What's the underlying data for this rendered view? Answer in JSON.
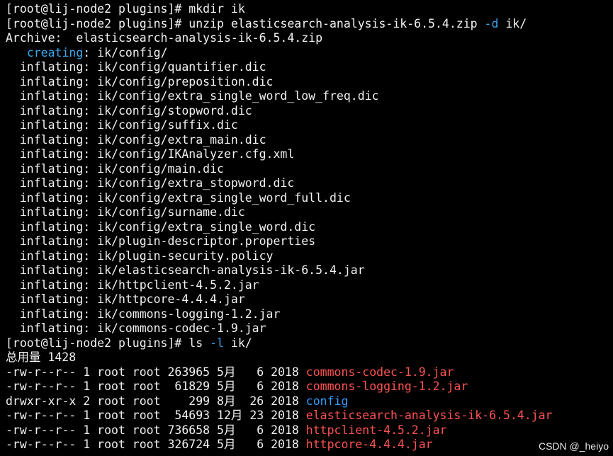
{
  "colors": {
    "text": "#f2f2f2",
    "background": "#000000",
    "cyan": "#38a8ee",
    "red": "#ff5252",
    "blue": "#2f9fff"
  },
  "lines": [
    {
      "segments": [
        {
          "text": "[root@lij-node2 plugins]# mkdir ik"
        }
      ]
    },
    {
      "segments": [
        {
          "text": "[root@lij-node2 plugins]# unzip elasticsearch-analysis-ik-6.5.4.zip "
        },
        {
          "text": "-d",
          "color": "cyan"
        },
        {
          "text": " ik/"
        }
      ]
    },
    {
      "segments": [
        {
          "text": "Archive:  elasticsearch-analysis-ik-6.5.4.zip"
        }
      ]
    },
    {
      "segments": [
        {
          "text": "   "
        },
        {
          "text": "creating",
          "color": "cyan"
        },
        {
          "text": ": ik/config/"
        }
      ]
    },
    {
      "segments": [
        {
          "text": "  inflating: ik/config/quantifier.dic"
        }
      ]
    },
    {
      "segments": [
        {
          "text": "  inflating: ik/config/preposition.dic"
        }
      ]
    },
    {
      "segments": [
        {
          "text": "  inflating: ik/config/extra_single_word_low_freq.dic"
        }
      ]
    },
    {
      "segments": [
        {
          "text": "  inflating: ik/config/stopword.dic"
        }
      ]
    },
    {
      "segments": [
        {
          "text": "  inflating: ik/config/suffix.dic"
        }
      ]
    },
    {
      "segments": [
        {
          "text": "  inflating: ik/config/extra_main.dic"
        }
      ]
    },
    {
      "segments": [
        {
          "text": "  inflating: ik/config/IKAnalyzer.cfg.xml"
        }
      ]
    },
    {
      "segments": [
        {
          "text": "  inflating: ik/config/main.dic"
        }
      ]
    },
    {
      "segments": [
        {
          "text": "  inflating: ik/config/extra_stopword.dic"
        }
      ]
    },
    {
      "segments": [
        {
          "text": "  inflating: ik/config/extra_single_word_full.dic"
        }
      ]
    },
    {
      "segments": [
        {
          "text": "  inflating: ik/config/surname.dic"
        }
      ]
    },
    {
      "segments": [
        {
          "text": "  inflating: ik/config/extra_single_word.dic"
        }
      ]
    },
    {
      "segments": [
        {
          "text": "  inflating: ik/plugin-descriptor.properties"
        }
      ]
    },
    {
      "segments": [
        {
          "text": "  inflating: ik/plugin-security.policy"
        }
      ]
    },
    {
      "segments": [
        {
          "text": "  inflating: ik/elasticsearch-analysis-ik-6.5.4.jar"
        }
      ]
    },
    {
      "segments": [
        {
          "text": "  inflating: ik/httpclient-4.5.2.jar"
        }
      ]
    },
    {
      "segments": [
        {
          "text": "  inflating: ik/httpcore-4.4.4.jar"
        }
      ]
    },
    {
      "segments": [
        {
          "text": "  inflating: ik/commons-logging-1.2.jar"
        }
      ]
    },
    {
      "segments": [
        {
          "text": "  inflating: ik/commons-codec-1.9.jar"
        }
      ]
    },
    {
      "segments": [
        {
          "text": "[root@lij-node2 plugins]# ls "
        },
        {
          "text": "-l",
          "color": "cyan"
        },
        {
          "text": " ik/"
        }
      ]
    },
    {
      "segments": [
        {
          "text": "总用量 1428"
        }
      ]
    },
    {
      "segments": [
        {
          "text": "-rw-r--r-- 1 root root 263965 5月   6 2018 "
        },
        {
          "text": "commons-codec-1.9.jar",
          "color": "red"
        }
      ]
    },
    {
      "segments": [
        {
          "text": "-rw-r--r-- 1 root root  61829 5月   6 2018 "
        },
        {
          "text": "commons-logging-1.2.jar",
          "color": "red"
        }
      ]
    },
    {
      "segments": [
        {
          "text": "drwxr-xr-x 2 root root    299 8月  26 2018 "
        },
        {
          "text": "config",
          "color": "blue"
        }
      ]
    },
    {
      "segments": [
        {
          "text": "-rw-r--r-- 1 root root  54693 12月 23 2018 "
        },
        {
          "text": "elasticsearch-analysis-ik-6.5.4.jar",
          "color": "red"
        }
      ]
    },
    {
      "segments": [
        {
          "text": "-rw-r--r-- 1 root root 736658 5月   6 2018 "
        },
        {
          "text": "httpclient-4.5.2.jar",
          "color": "red"
        }
      ]
    },
    {
      "segments": [
        {
          "text": "-rw-r--r-- 1 root root 326724 5月   6 2018 "
        },
        {
          "text": "httpcore-4.4.4.jar",
          "color": "red"
        }
      ]
    }
  ],
  "watermark": "CSDN @_heiyo"
}
